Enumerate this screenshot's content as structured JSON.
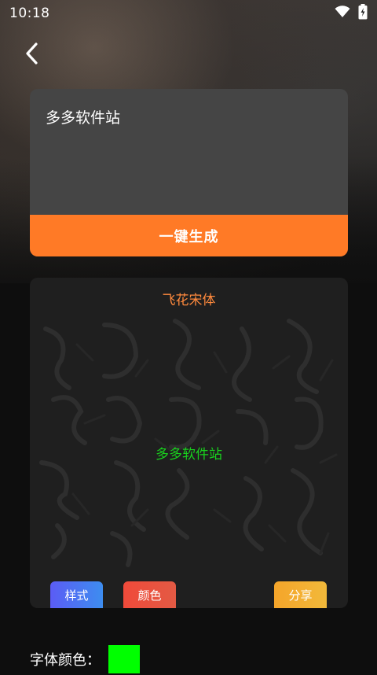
{
  "status_bar": {
    "time": "10:18",
    "wifi_icon": "wifi-icon",
    "battery_icon": "battery-charging-icon"
  },
  "nav": {
    "back_icon": "chevron-left-icon"
  },
  "input_card": {
    "text": "多多软件站",
    "generate_label": "一键生成"
  },
  "preview": {
    "font_name": "飞花宋体",
    "sample_text": "多多软件站",
    "sample_color": "#19d21e",
    "buttons": {
      "style_label": "样式",
      "color_label": "颜色",
      "share_label": "分享"
    }
  },
  "font_color": {
    "label": "字体颜色：",
    "swatch": "#00ff00"
  },
  "colors": {
    "accent_orange": "#ff7a26",
    "font_name_orange": "#ff8a3d",
    "card_gray": "#454545",
    "preview_card": "#1f1f1f"
  }
}
